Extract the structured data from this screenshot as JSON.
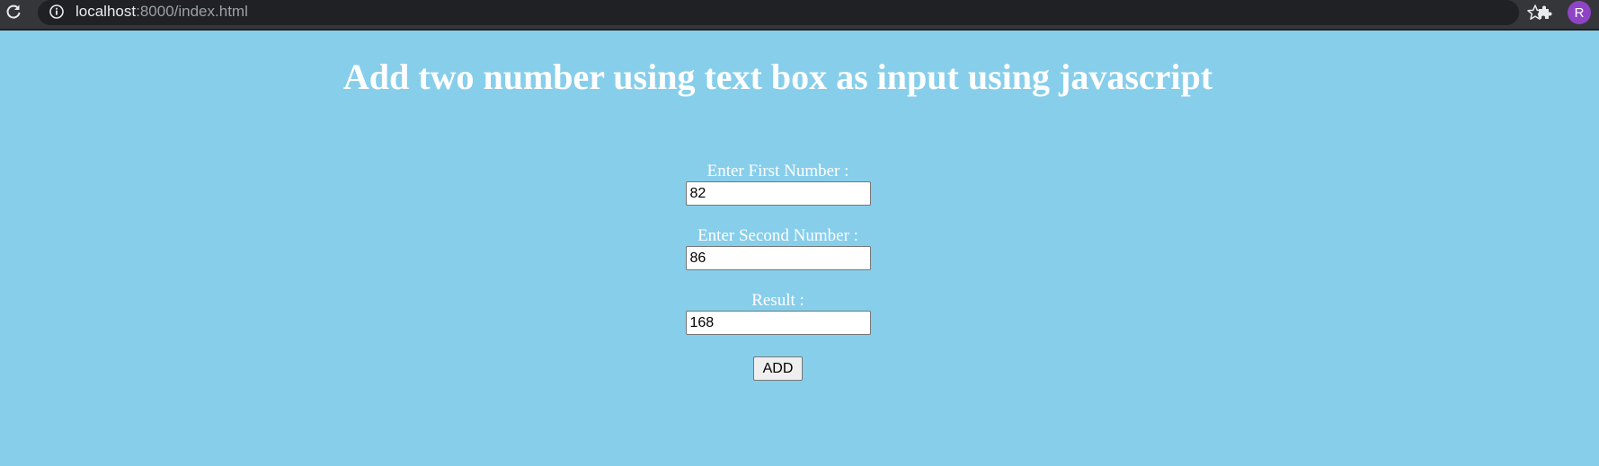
{
  "browser": {
    "url_host": "localhost",
    "url_rest": ":8000/index.html",
    "avatar_letter": "R",
    "icons": {
      "reload": "reload-icon",
      "info": "info-icon",
      "star": "star-icon",
      "extensions": "puzzle-icon"
    }
  },
  "page": {
    "title": "Add two number using text box as input using javascript",
    "background_color": "#87ceeb",
    "fields": {
      "first": {
        "label": "Enter First Number :",
        "value": "82"
      },
      "second": {
        "label": "Enter Second Number :",
        "value": "86"
      },
      "result": {
        "label": "Result :",
        "value": "168"
      }
    },
    "add_button_label": "ADD"
  }
}
